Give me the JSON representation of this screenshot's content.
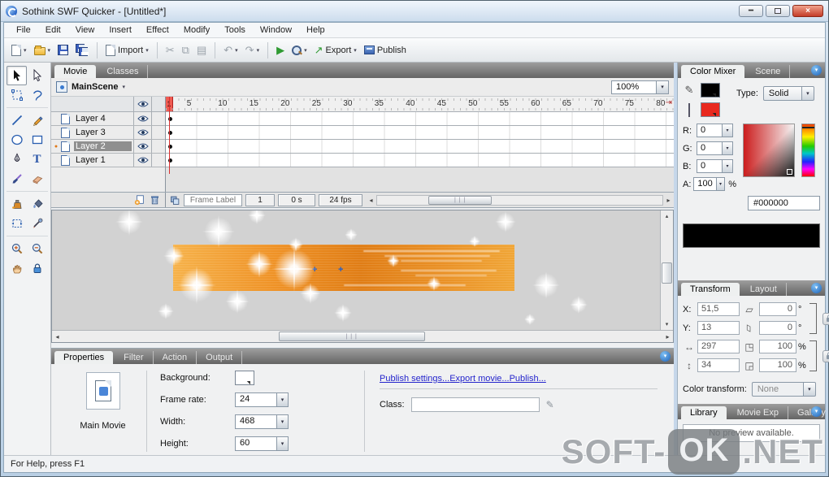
{
  "window": {
    "title": "Sothink SWF Quicker - [Untitled*]",
    "controls": {
      "minimize": "minimize",
      "maximize": "maximize",
      "close": "close"
    },
    "status_bar": "For Help, press F1",
    "watermark": {
      "prefix": "SOFT-",
      "boxed": "OK",
      "suffix": ".NET"
    }
  },
  "menu": {
    "items": [
      "File",
      "Edit",
      "View",
      "Insert",
      "Effect",
      "Modify",
      "Tools",
      "Window",
      "Help"
    ]
  },
  "toolbar": {
    "import_label": "Import",
    "export_label": "Export",
    "publish_label": "Publish"
  },
  "toolbox": {
    "tools": [
      "selection",
      "subselection",
      "free-transform",
      "lasso",
      "line",
      "pencil",
      "oval",
      "rectangle",
      "pen",
      "text",
      "brush",
      "eraser",
      "ink-bottle",
      "paint-bucket",
      "transform-fill",
      "eyedropper",
      "zoom-in",
      "zoom-out",
      "hand",
      "lock"
    ],
    "selected": "selection",
    "text_tool_glyph": "T"
  },
  "timeline": {
    "tabs": [
      {
        "label": "Movie",
        "active": true
      },
      {
        "label": "Classes",
        "active": false
      }
    ],
    "scene_name": "MainScene",
    "zoom_value": "100%",
    "ruler_numbers": [
      5,
      10,
      15,
      20,
      25,
      30,
      35,
      40,
      45,
      50,
      55,
      60,
      65,
      70,
      75,
      80
    ],
    "playhead_frame": "1",
    "layers": [
      {
        "name": "Layer 4",
        "selected": false
      },
      {
        "name": "Layer 3",
        "selected": false
      },
      {
        "name": "Layer 2",
        "selected": true
      },
      {
        "name": "Layer 1",
        "selected": false
      }
    ],
    "frame_label_placeholder": "Frame Label",
    "current_frame": "1",
    "elapsed_time": "0 s",
    "frame_rate": "24 fps"
  },
  "properties": {
    "tabs": [
      {
        "label": "Properties",
        "active": true
      },
      {
        "label": "Filter",
        "active": false
      },
      {
        "label": "Action",
        "active": false
      },
      {
        "label": "Output",
        "active": false
      }
    ],
    "movie_label": "Main Movie",
    "background_label": "Background:",
    "frame_rate_label": "Frame rate:",
    "frame_rate_value": "24",
    "width_label": "Width:",
    "width_value": "468",
    "height_label": "Height:",
    "height_value": "60",
    "links": [
      "Publish settings...",
      "Export movie...",
      "Publish..."
    ],
    "class_label": "Class:",
    "class_value": ""
  },
  "color_mixer": {
    "tabs": [
      {
        "label": "Color Mixer",
        "active": true
      },
      {
        "label": "Scene",
        "active": false
      }
    ],
    "type_label": "Type:",
    "type_value": "Solid",
    "channels": [
      {
        "label": "R:",
        "value": "0",
        "suffix": ""
      },
      {
        "label": "G:",
        "value": "0",
        "suffix": ""
      },
      {
        "label": "B:",
        "value": "0",
        "suffix": ""
      },
      {
        "label": "A:",
        "value": "100",
        "suffix": "%"
      }
    ],
    "hex_value": "#000000",
    "stroke_color": "#000000",
    "fill_color": "#e8281e",
    "preview_color": "#000000"
  },
  "transform": {
    "tabs": [
      {
        "label": "Transform",
        "active": true
      },
      {
        "label": "Layout",
        "active": false
      }
    ],
    "x_label": "X:",
    "x_value": "51,5",
    "y_label": "Y:",
    "y_value": "13",
    "width_value": "297",
    "height_value": "34",
    "skew_x_value": "0",
    "skew_y_value": "0",
    "scale_x_value": "100",
    "scale_y_value": "100",
    "degree_suffix": "°",
    "percent_suffix": "%",
    "color_transform_label": "Color transform:",
    "color_transform_value": "None"
  },
  "library": {
    "tabs": [
      {
        "label": "Library",
        "active": true
      },
      {
        "label": "Movie Exp",
        "active": false
      },
      {
        "label": "Gallery",
        "active": false
      }
    ],
    "no_preview_text": "No preview available."
  }
}
